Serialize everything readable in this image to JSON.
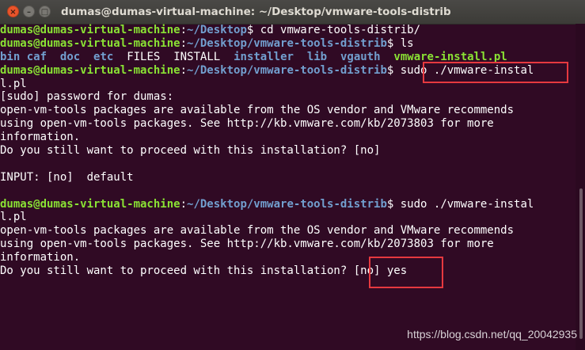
{
  "window": {
    "title": "dumas@dumas-virtual-machine: ~/Desktop/vmware-tools-distrib",
    "close_glyph": "×",
    "minimize_glyph": "–",
    "maximize_glyph": "□"
  },
  "colors": {
    "background": "#300a24",
    "prompt_user": "#8ae234",
    "prompt_path": "#729fcf",
    "highlight_box": "#e6393f"
  },
  "prompt": {
    "user_host": "dumas@dumas-virtual-machine",
    "sep": ":",
    "path_home": "~/Desktop",
    "path_distrib": "~/Desktop/vmware-tools-distrib",
    "dollar": "$ "
  },
  "commands": {
    "cd": "cd vmware-tools-distrib/",
    "ls": "ls",
    "sudo_1": "sudo ./vmware-instal",
    "sudo_1_wrap": "l.pl",
    "sudo_2": "sudo ./vmware-instal",
    "sudo_2_wrap": "l.pl"
  },
  "ls_output": [
    {
      "name": "bin",
      "kind": "dir",
      "gap": " "
    },
    {
      "name": "caf",
      "kind": "dir",
      "gap": "  "
    },
    {
      "name": "doc",
      "kind": "dir",
      "gap": "  "
    },
    {
      "name": "etc",
      "kind": "dir",
      "gap": "  "
    },
    {
      "name": "FILES",
      "kind": "file",
      "gap": "  "
    },
    {
      "name": "INSTALL",
      "kind": "file",
      "gap": "  "
    },
    {
      "name": "installer",
      "kind": "dir",
      "gap": "  "
    },
    {
      "name": "lib",
      "kind": "dir",
      "gap": "  "
    },
    {
      "name": "vgauth",
      "kind": "dir",
      "gap": "  "
    },
    {
      "name": "vmware-install.pl",
      "kind": "exec",
      "gap": ""
    }
  ],
  "output": {
    "sudo_password": "[sudo] password for dumas:",
    "msg_line1": "open-vm-tools packages are available from the OS vendor and VMware recommends",
    "msg_line2": "using open-vm-tools packages. See http://kb.vmware.com/kb/2073803 for more",
    "msg_line3": "information.",
    "question_1": "Do you still want to proceed with this installation? [no]",
    "input_default": "INPUT: [no]  default",
    "question_2": "Do you still want to proceed with this installation? [no] yes"
  },
  "watermark": "https://blog.csdn.net/qq_20042935"
}
